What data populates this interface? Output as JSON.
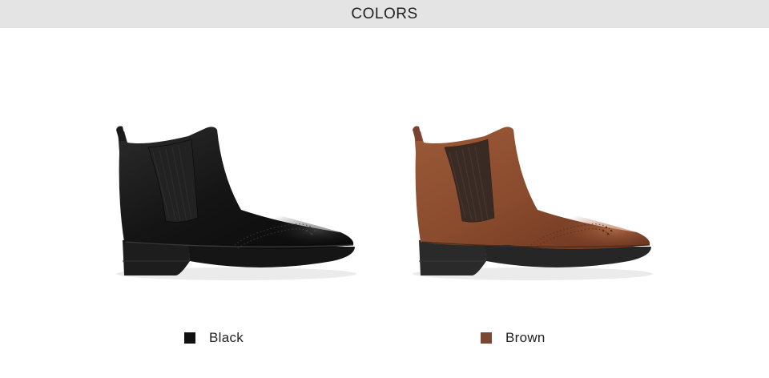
{
  "header": {
    "title": "COLORS"
  },
  "products": [
    {
      "color_name": "Black",
      "swatch_color": "#111111",
      "icon": "black-chelsea-boot-image"
    },
    {
      "color_name": "Brown",
      "swatch_color": "#7a4733",
      "icon": "brown-chelsea-boot-image"
    }
  ]
}
